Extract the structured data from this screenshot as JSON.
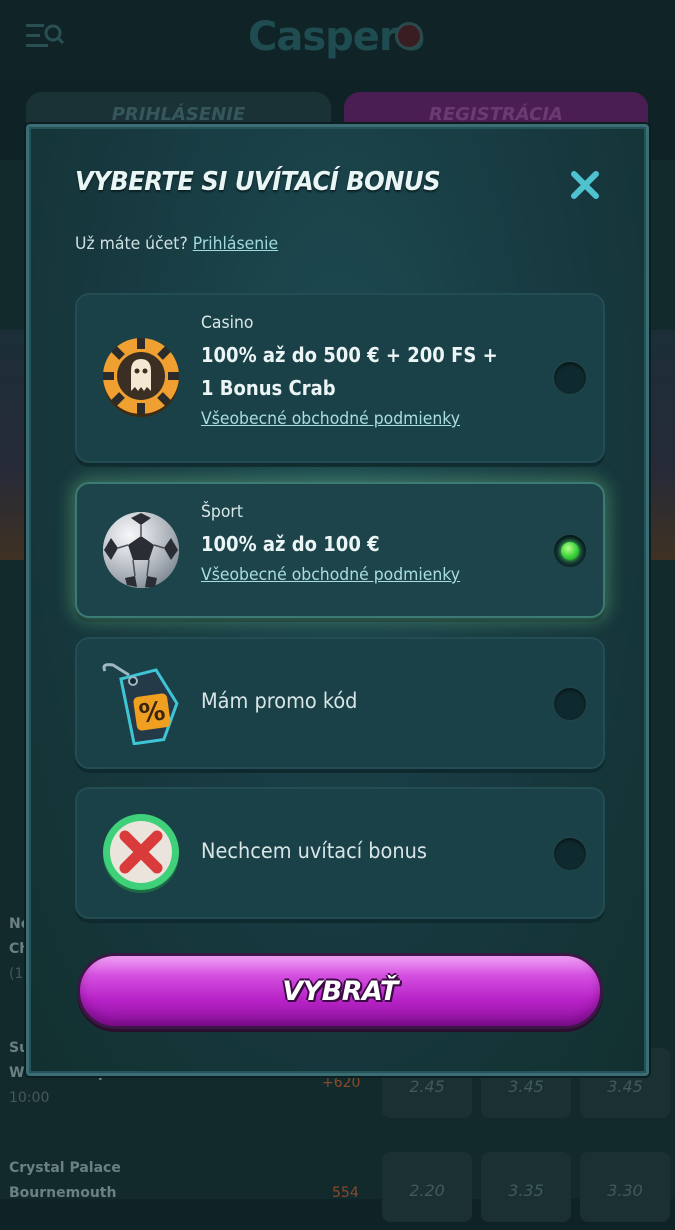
{
  "header": {
    "logo": "Caspero"
  },
  "bg_tabs": {
    "login": "PRIHLÁSENIE",
    "register": "REGISTRÁCIA"
  },
  "bg_matches": [
    {
      "team1": "No",
      "team2": "Ch",
      "time": "(1",
      "odds": [],
      "change": ""
    },
    {
      "team1": "Su",
      "team2": "Wolverhampton",
      "time": "10:00",
      "odds": [
        "2.45",
        "3.45",
        "3.45"
      ],
      "change": "+620"
    },
    {
      "team1": "Crystal Palace",
      "team2": "Bournemouth",
      "time": "",
      "odds": [
        "2.20",
        "3.35",
        "3.30"
      ],
      "change": "554"
    }
  ],
  "modal": {
    "title": "VYBERTE SI UVÍTACÍ BONUS",
    "account_prompt": "Už máte účet?",
    "login_link": "Prihlásenie",
    "options": [
      {
        "category": "Casino",
        "bonus_line1": "100% až do 500 € + 200 FS +",
        "bonus_line2": "1 Bonus Crab",
        "terms": "Všeobecné obchodné podmienky",
        "selected": false,
        "icon": "casino-chip-icon"
      },
      {
        "category": "Šport",
        "bonus_line1": "100% až do 100 €",
        "terms": "Všeobecné obchodné podmienky",
        "selected": true,
        "icon": "soccer-ball-icon"
      },
      {
        "label": "Mám promo kód",
        "selected": false,
        "icon": "promo-tag-icon"
      },
      {
        "label": "Nechcem uvítací bonus",
        "selected": false,
        "icon": "red-x-icon"
      }
    ],
    "submit_label": "VYBRAŤ"
  },
  "colors": {
    "accent_purple": "#b823c7",
    "selected_radio": "#38d23a",
    "link": "#9fd9df"
  }
}
